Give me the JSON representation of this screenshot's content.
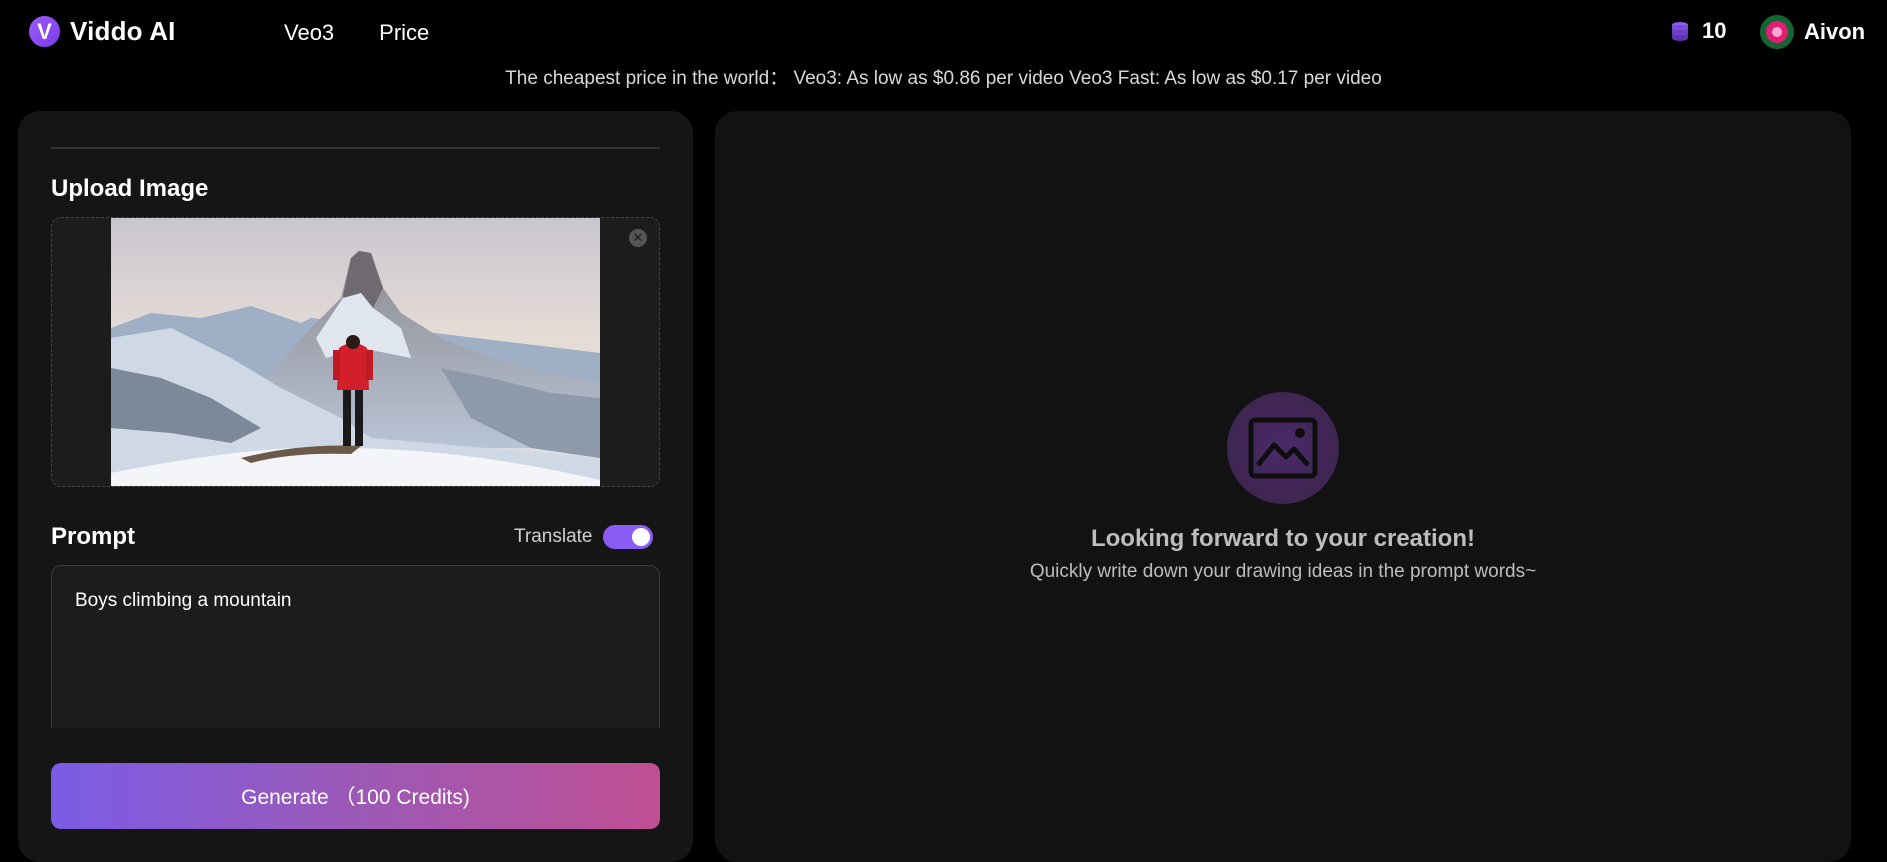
{
  "header": {
    "brand": "Viddo AI",
    "brand_mark": "V",
    "nav": [
      {
        "label": "Veo3"
      },
      {
        "label": "Price"
      }
    ],
    "credits": "10",
    "credits_icon": "coin-stack-icon",
    "user_name": "Aivon"
  },
  "promo_text": "The cheapest price in the world：  Veo3: As low as $0.86 per video Veo3 Fast: As low as $0.17 per video",
  "left_panel": {
    "upload_title": "Upload Image",
    "remove_icon": "close-circle-icon",
    "prompt_title": "Prompt",
    "translate_label": "Translate",
    "translate_enabled": true,
    "prompt_value": "Boys climbing a mountain",
    "generate_label": "Generate （100 Credits)"
  },
  "right_panel": {
    "empty_icon": "image-placeholder-icon",
    "empty_title": "Looking forward to your creation!",
    "empty_subtitle": "Quickly write down your drawing ideas in the prompt words~"
  },
  "colors": {
    "accent": "#8b5cf6",
    "generate_gradient_start": "#7b5ce6",
    "generate_gradient_end": "#c04f93",
    "background": "#000000",
    "panel": "#151515"
  }
}
